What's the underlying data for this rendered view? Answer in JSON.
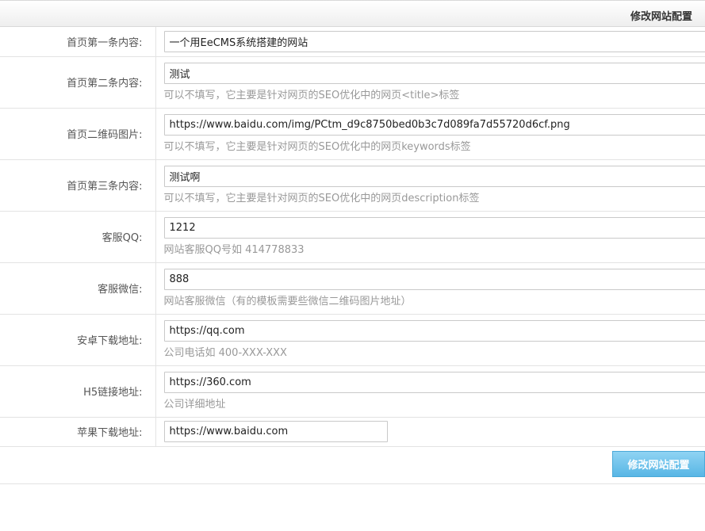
{
  "header": {
    "title": "修改网站配置"
  },
  "fields": [
    {
      "label": "首页第一条内容:",
      "value": "一个用EeCMS系统搭建的网站",
      "hint": ""
    },
    {
      "label": "首页第二条内容:",
      "value": "测试",
      "hint": "可以不填写，它主要是针对网页的SEO优化中的网页<title>标签"
    },
    {
      "label": "首页二维码图片:",
      "value": "https://www.baidu.com/img/PCtm_d9c8750bed0b3c7d089fa7d55720d6cf.png",
      "hint": "可以不填写，它主要是针对网页的SEO优化中的网页keywords标签"
    },
    {
      "label": "首页第三条内容:",
      "value": "测试啊",
      "hint": "可以不填写，它主要是针对网页的SEO优化中的网页description标签"
    },
    {
      "label": "客服QQ:",
      "value": "1212",
      "hint": "网站客服QQ号如 414778833"
    },
    {
      "label": "客服微信:",
      "value": "888",
      "hint": "网站客服微信（有的模板需要些微信二维码图片地址）"
    },
    {
      "label": "安卓下载地址:",
      "value": "https://qq.com",
      "hint": "公司电话如 400-XXX-XXX"
    },
    {
      "label": "H5链接地址:",
      "value": "https://360.com",
      "hint": "公司详细地址"
    },
    {
      "label": "苹果下载地址:",
      "value": "https://www.baidu.com",
      "hint": ""
    }
  ],
  "footer": {
    "submit_label": "修改网站配置"
  }
}
